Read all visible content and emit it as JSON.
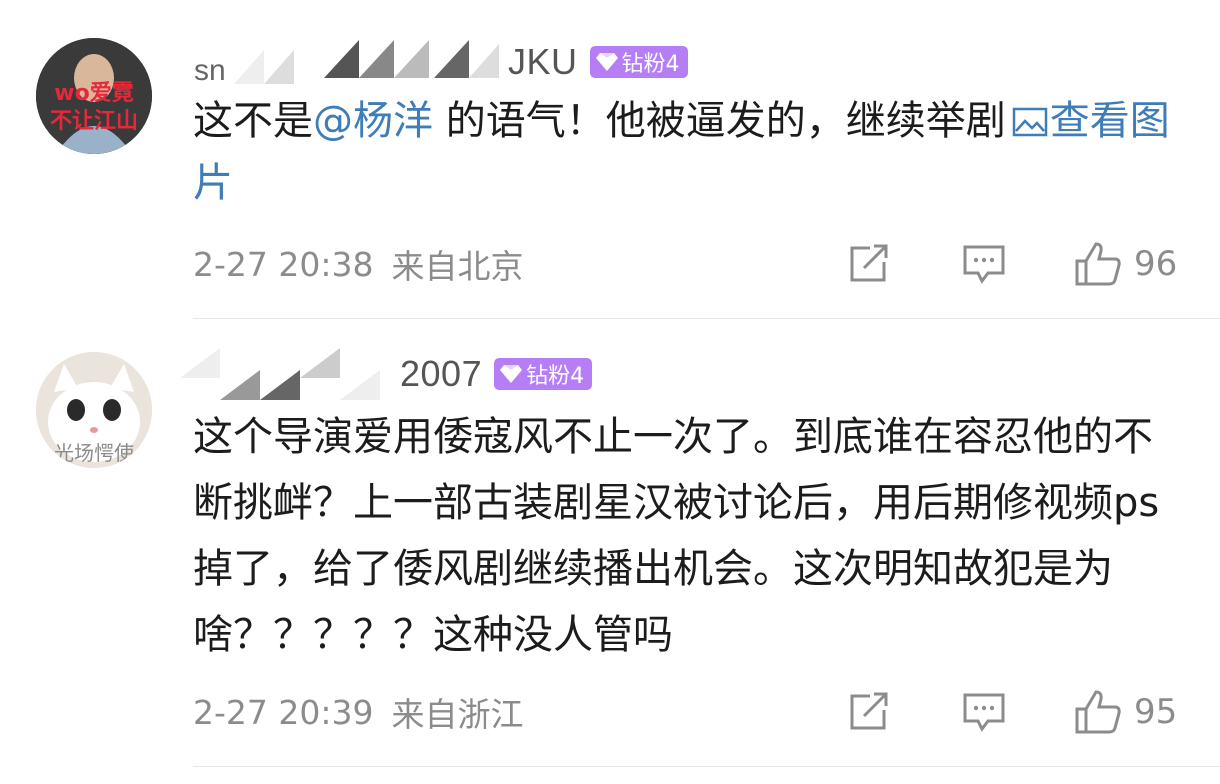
{
  "comments": [
    {
      "username_visible": "JKU",
      "avatar_text": "",
      "badge": "钻粉4",
      "text_before": "这不是",
      "mention": "@杨洋",
      "text_after": " 的语气！他被逼发的，继续举剧",
      "view_image": "查看图片",
      "time": "2-27 20:38",
      "location": "来自北京",
      "likes": "96",
      "avatar_colors": {
        "bg": "#2a2a2a",
        "text": "#e6283a"
      }
    },
    {
      "username_visible": "2007",
      "avatar_text": "",
      "badge": "钻粉4",
      "text": "这个导演爱用倭寇风不止一次了。到底谁在容忍他的不断挑衅？上一部古装剧星汉被讨论后，用后期修视频ps掉了，给了倭风剧继续播出机会。这次明知故犯是为啥？？？？？这种没人管吗",
      "time": "2-27 20:39",
      "location": "来自浙江",
      "likes": "95"
    }
  ],
  "icons": {
    "repost": "share-icon",
    "comment": "comment-icon",
    "like": "thumbs-up-icon",
    "image": "image-icon",
    "badge": "diamond-icon"
  },
  "colors": {
    "link": "#3e7db8",
    "badge": "#b57ef5",
    "meta": "#8c8c8c"
  }
}
